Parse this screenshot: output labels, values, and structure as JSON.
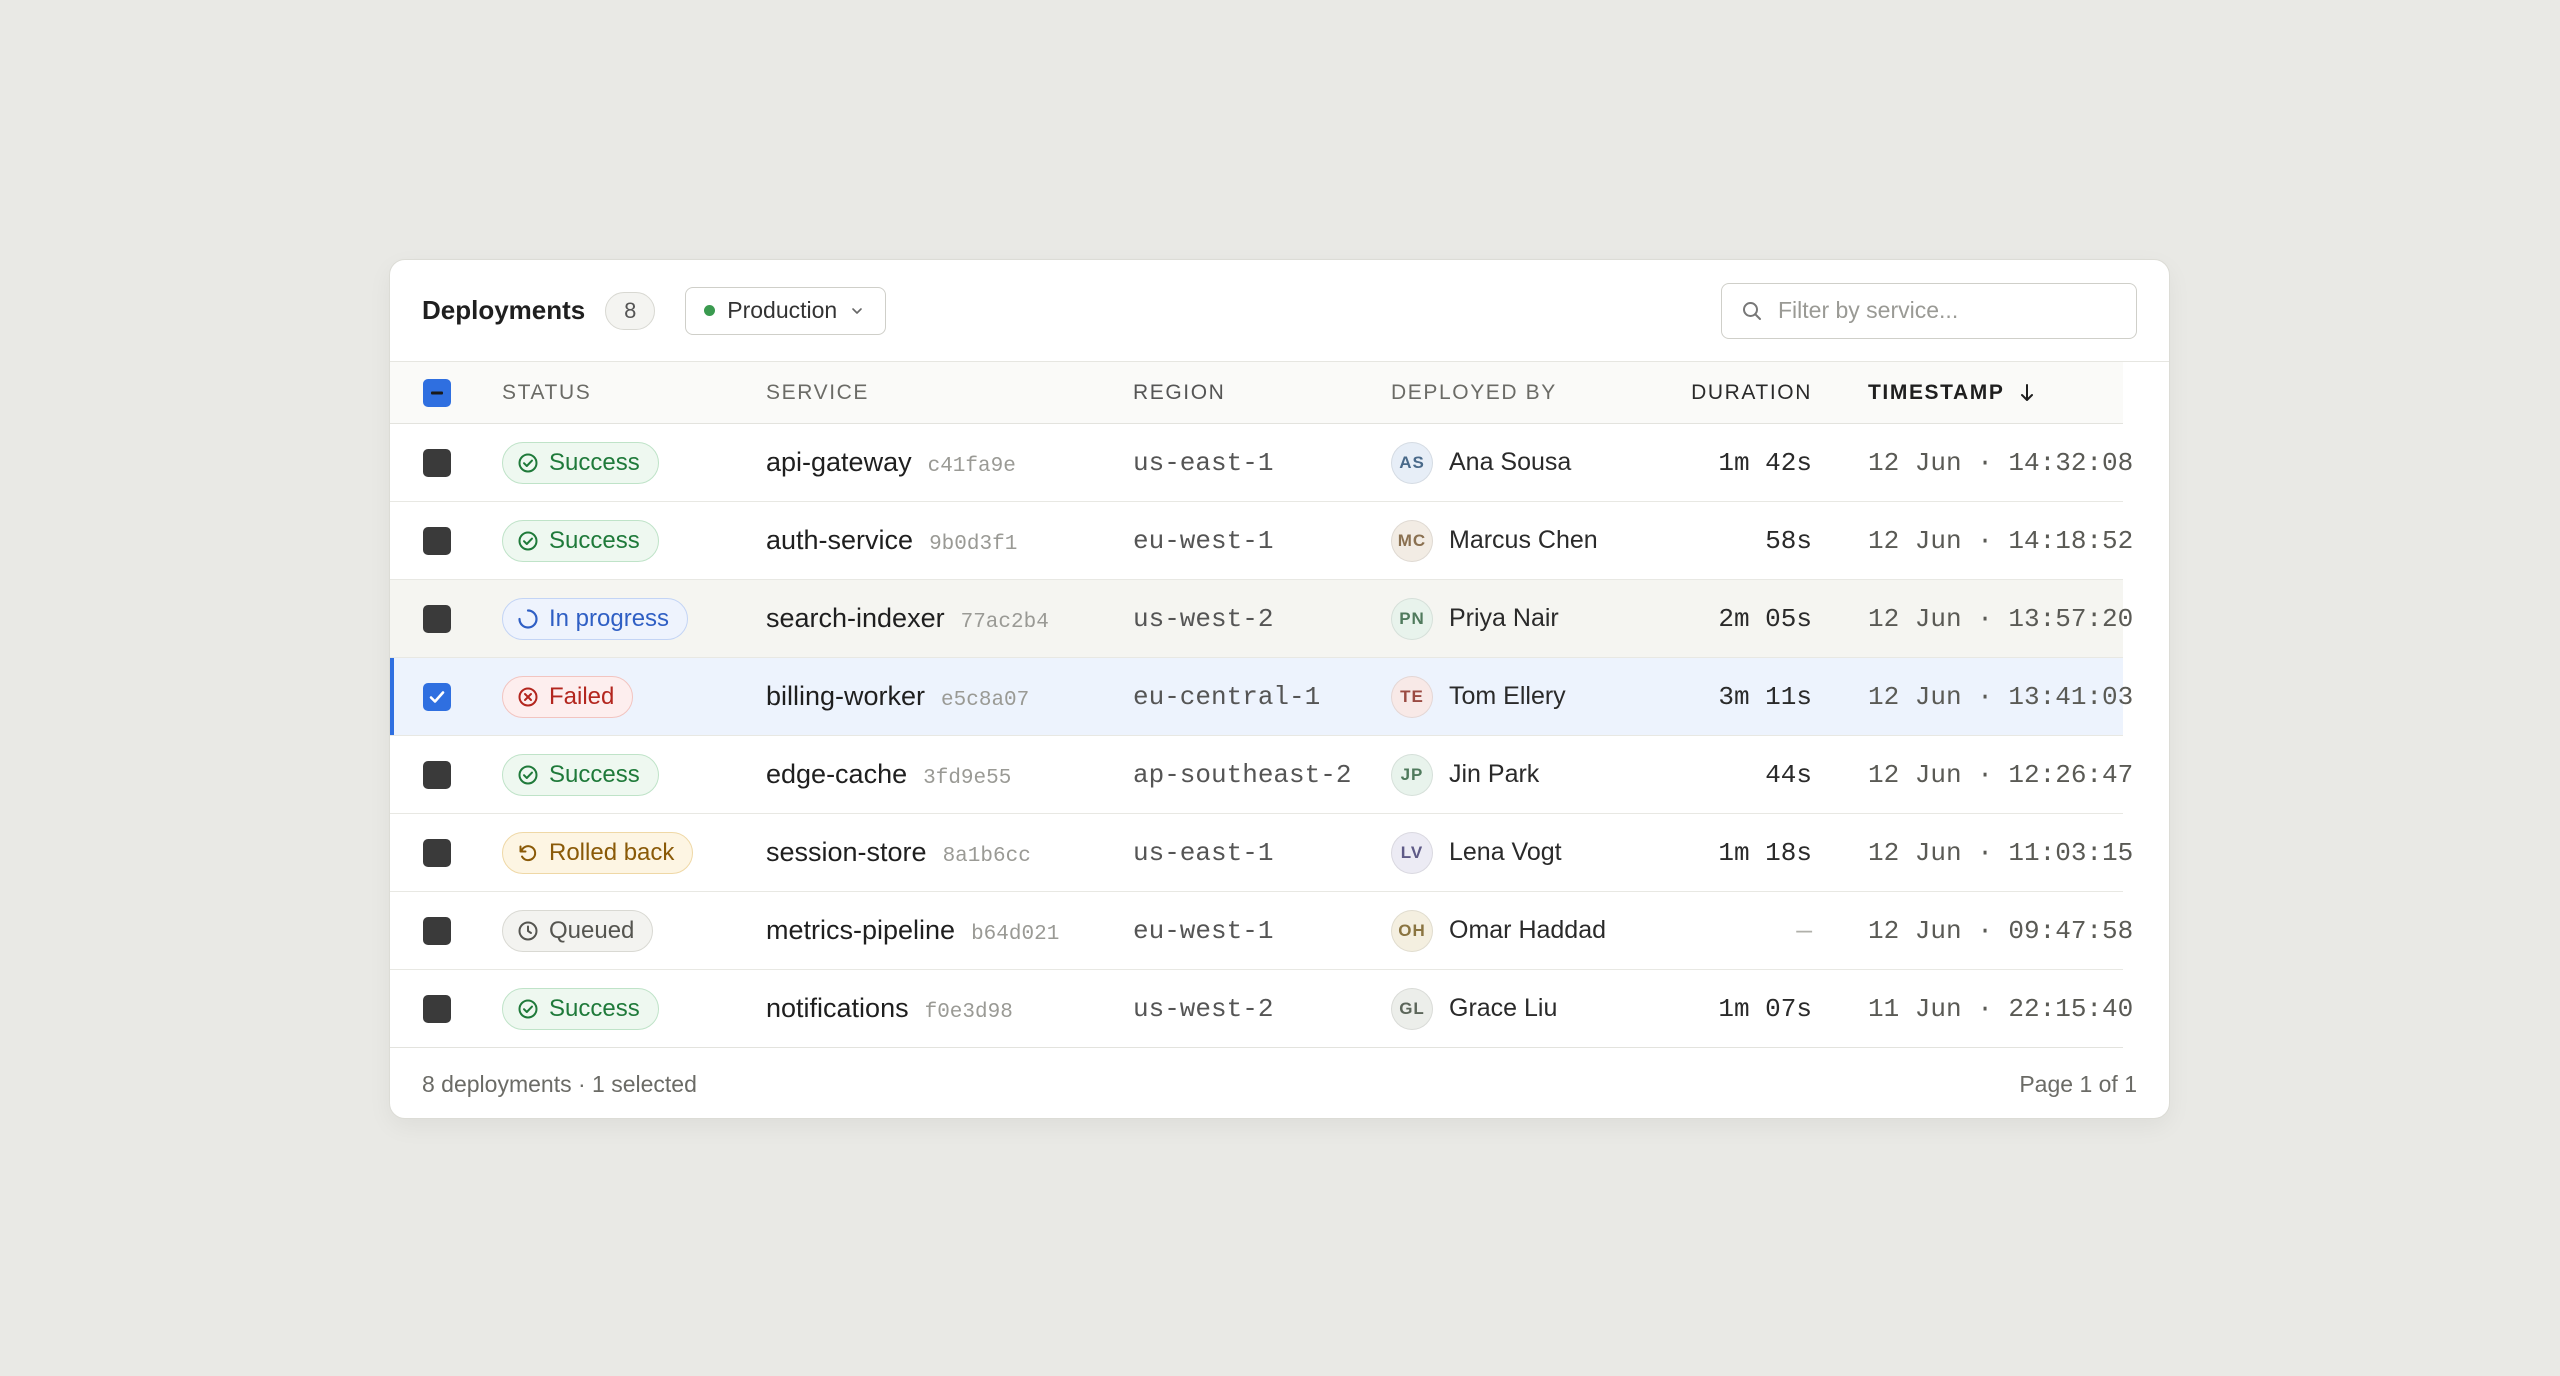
{
  "header": {
    "title": "Deployments",
    "count": "8",
    "environment": "Production",
    "search_placeholder": "Filter by service..."
  },
  "columns": {
    "status": "STATUS",
    "service": "SERVICE",
    "region": "REGION",
    "deployed_by": "DEPLOYED BY",
    "duration": "DURATION",
    "timestamp": "TIMESTAMP"
  },
  "colors": {
    "accent": "#2f6fe0",
    "success": "#1f7a3a",
    "in_progress": "#2f5fc4",
    "failed": "#b3261e",
    "rolled_back": "#8a5a08",
    "queued": "#555550"
  },
  "rows": [
    {
      "status": "Success",
      "kind": "success",
      "icon": "check-circle-icon",
      "service": "api-gateway",
      "hash": "c41fa9e",
      "region": "us-east-1",
      "initials": "AS",
      "avatar_bg": "#e7eef7",
      "avatar_fg": "#4a6a8a",
      "by": "Ana Sousa",
      "duration": "1m 42s",
      "timestamp": "12 Jun · 14:32:08",
      "checked": false
    },
    {
      "status": "Success",
      "kind": "success",
      "icon": "check-circle-icon",
      "service": "auth-service",
      "hash": "9b0d3f1",
      "region": "eu-west-1",
      "initials": "MC",
      "avatar_bg": "#f2ece4",
      "avatar_fg": "#8a7050",
      "by": "Marcus Chen",
      "duration": "58s",
      "timestamp": "12 Jun · 14:18:52",
      "checked": false
    },
    {
      "status": "In progress",
      "kind": "progress",
      "icon": "spinner-icon",
      "service": "search-indexer",
      "hash": "77ac2b4",
      "region": "us-west-2",
      "initials": "PN",
      "avatar_bg": "#e8f3ec",
      "avatar_fg": "#4f7a5c",
      "by": "Priya Nair",
      "duration": "2m 05s",
      "timestamp": "12 Jun · 13:57:20",
      "checked": false
    },
    {
      "status": "Failed",
      "kind": "failed",
      "icon": "x-circle-icon",
      "service": "billing-worker",
      "hash": "e5c8a07",
      "region": "eu-central-1",
      "initials": "TE",
      "avatar_bg": "#f8e9e7",
      "avatar_fg": "#9a4a42",
      "by": "Tom Ellery",
      "duration": "3m 11s",
      "timestamp": "12 Jun · 13:41:03",
      "checked": true
    },
    {
      "status": "Success",
      "kind": "success",
      "icon": "check-circle-icon",
      "service": "edge-cache",
      "hash": "3fd9e55",
      "region": "ap-southeast-2",
      "initials": "JP",
      "avatar_bg": "#e8f3ec",
      "avatar_fg": "#4f7a5c",
      "by": "Jin Park",
      "duration": "44s",
      "timestamp": "12 Jun · 12:26:47",
      "checked": false
    },
    {
      "status": "Rolled back",
      "kind": "rolled",
      "icon": "rotate-ccw-icon",
      "service": "session-store",
      "hash": "8a1b6cc",
      "region": "us-east-1",
      "initials": "LV",
      "avatar_bg": "#ecebf4",
      "avatar_fg": "#5e5a86",
      "by": "Lena Vogt",
      "duration": "1m 18s",
      "timestamp": "12 Jun · 11:03:15",
      "checked": false
    },
    {
      "status": "Queued",
      "kind": "queued",
      "icon": "clock-icon",
      "service": "metrics-pipeline",
      "hash": "b64d021",
      "region": "eu-west-1",
      "initials": "OH",
      "avatar_bg": "#f4efe0",
      "avatar_fg": "#8a7440",
      "by": "Omar Haddad",
      "duration": "—",
      "timestamp": "12 Jun · 09:47:58",
      "checked": false
    },
    {
      "status": "Success",
      "kind": "success",
      "icon": "check-circle-icon",
      "service": "notifications",
      "hash": "f0e3d98",
      "region": "us-west-2",
      "initials": "GL",
      "avatar_bg": "#eceeea",
      "avatar_fg": "#5c665a",
      "by": "Grace Liu",
      "duration": "1m 07s",
      "timestamp": "11 Jun · 22:15:40",
      "checked": false
    }
  ],
  "footer": {
    "summary": "8 deployments · 1 selected",
    "pagination": "Page 1 of 1"
  }
}
